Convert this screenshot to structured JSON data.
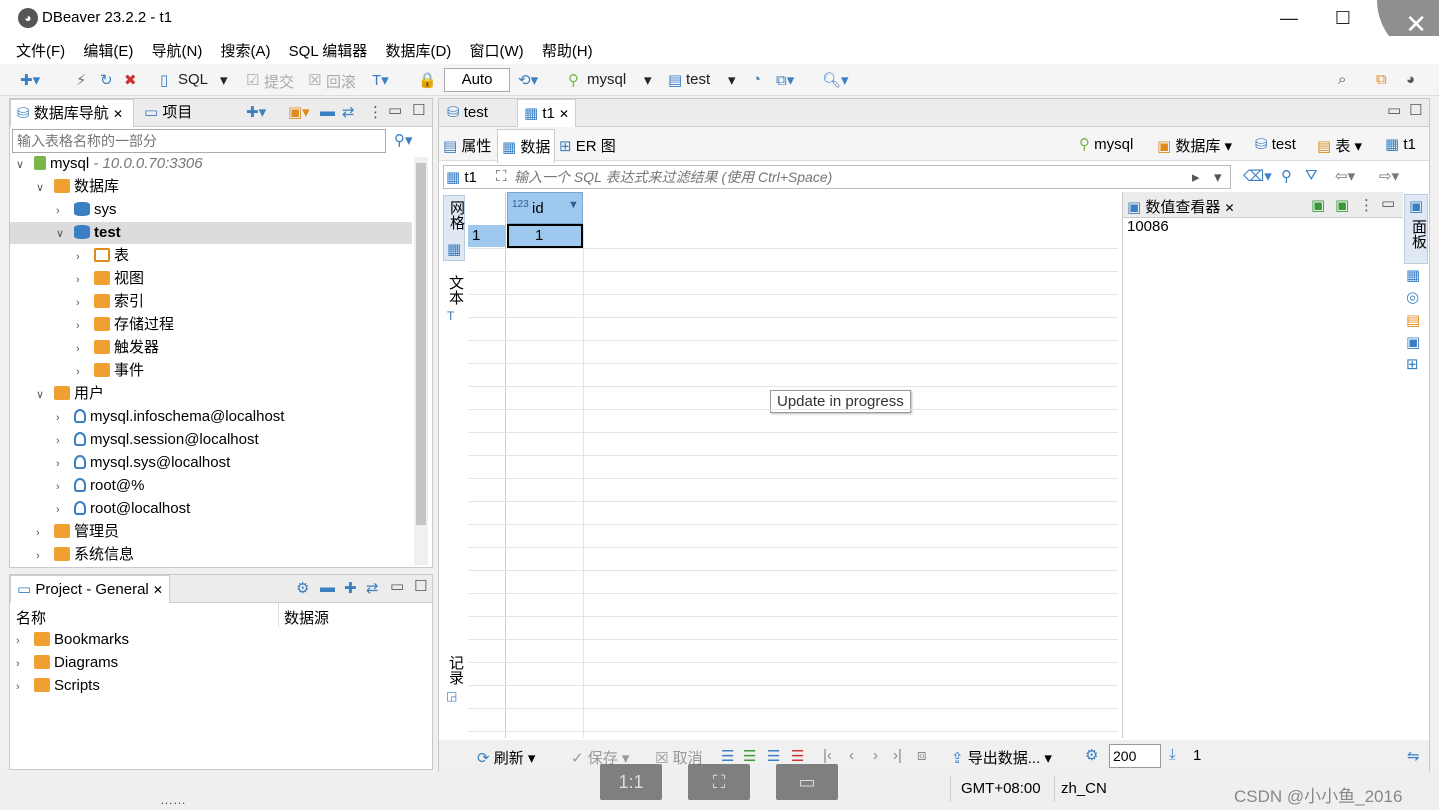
{
  "window": {
    "title": "DBeaver 23.2.2 - t1",
    "minimize": "—",
    "maximize": "☐",
    "close": "✕"
  },
  "menu": [
    "文件(F)",
    "编辑(E)",
    "导航(N)",
    "搜索(A)",
    "SQL 编辑器",
    "数据库(D)",
    "窗口(W)",
    "帮助(H)"
  ],
  "toolbar": {
    "sql": "SQL",
    "commit": "提交",
    "rollback": "回滚",
    "mode": "Auto",
    "connection": "mysql",
    "database": "test"
  },
  "navigator": {
    "tab_db": "数据库导航",
    "tab_project": "项目",
    "filter_placeholder": "输入表格名称的一部分",
    "conn_name": "mysql",
    "conn_host": "- 10.0.0.70:3306",
    "databases": "数据库",
    "db_sys": "sys",
    "db_test": "test",
    "tables": "表",
    "views": "视图",
    "indexes": "索引",
    "procedures": "存储过程",
    "triggers": "触发器",
    "events": "事件",
    "users": "用户",
    "user1": "mysql.infoschema@localhost",
    "user2": "mysql.session@localhost",
    "user3": "mysql.sys@localhost",
    "user4": "root@%",
    "user5": "root@localhost",
    "admin": "管理员",
    "sysinfo": "系统信息"
  },
  "project": {
    "tab": "Project - General",
    "col_name": "名称",
    "col_source": "数据源",
    "items": [
      "Bookmarks",
      "Diagrams",
      "Scripts"
    ]
  },
  "editor": {
    "tab_test": "test",
    "tab_t1": "t1",
    "sub_props": "属性",
    "sub_data": "数据",
    "sub_er": "ER 图",
    "crumb_conn": "mysql",
    "crumb_db": "数据库",
    "crumb_schema": "test",
    "crumb_tables": "表",
    "crumb_table": "t1",
    "filter_table": "t1",
    "filter_placeholder": "输入一个 SQL 表达式来过滤结果 (使用 Ctrl+Space)",
    "side_grid": "网格",
    "side_text": "文本",
    "side_record": "记录",
    "col_type": "123",
    "col_name": "id",
    "row_num": "1",
    "cell_value": "1",
    "update_msg": "Update in progress"
  },
  "value_viewer": {
    "title": "数值查看器",
    "value": "10086",
    "panel_label": "面板"
  },
  "bottom_toolbar": {
    "refresh": "刷新",
    "save": "保存",
    "cancel": "取消",
    "export": "导出数据...",
    "fetch_size": "200",
    "row_count": "1"
  },
  "status": {
    "tz": "GMT+08:00",
    "locale": "zh_CN",
    "watermark": "CSDN @小小鱼_2016"
  },
  "overlay": {
    "btn1": "1:1"
  }
}
